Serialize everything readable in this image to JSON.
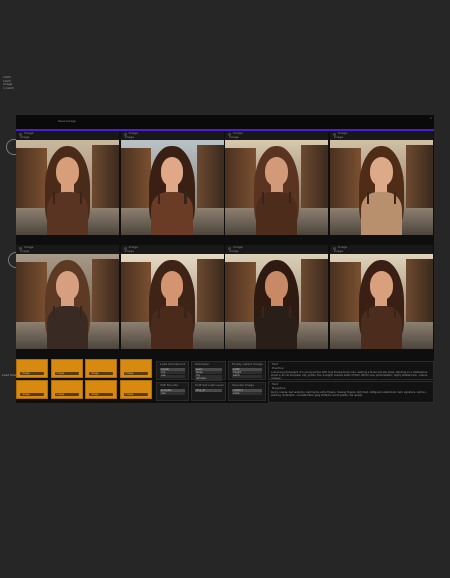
{
  "side_info": {
    "lines": [
      "1024",
      "1024",
      "Image",
      "1 batch"
    ]
  },
  "topbar": {
    "title": "Save Image",
    "right_label": "x"
  },
  "accent_color": "#4b1fd1",
  "orange_color": "#d88a10",
  "grid_rows": [
    {
      "cells": [
        {
          "title": "Image",
          "subtitle": "Image"
        },
        {
          "title": "Image",
          "subtitle": "Image"
        },
        {
          "title": "Image",
          "subtitle": "Image"
        },
        {
          "title": "Image",
          "subtitle": "Image"
        }
      ]
    },
    {
      "cells": [
        {
          "title": "Image",
          "subtitle": "Image"
        },
        {
          "title": "Image",
          "subtitle": "Image"
        },
        {
          "title": "Image",
          "subtitle": "Image"
        },
        {
          "title": "Image",
          "subtitle": "Image"
        }
      ]
    }
  ],
  "bottom": {
    "left_label": "Load Images",
    "orange_buttons": [
      "image",
      "image",
      "image",
      "image",
      "image",
      "image",
      "image",
      "image"
    ],
    "panels": [
      {
        "title": "Load Checkpoint",
        "fields": [
          "model",
          "clip",
          "vae"
        ]
      },
      {
        "title": "KSampler",
        "fields": [
          "seed",
          "steps",
          "cfg",
          "denoise"
        ]
      },
      {
        "title": "Empty Latent Image",
        "fields": [
          "width",
          "height",
          "batch"
        ]
      },
      {
        "title": "VAE Decode",
        "fields": [
          "samples",
          "vae"
        ]
      },
      {
        "title": "CLIP Set Last Layer",
        "fields": [
          "stop_at"
        ]
      },
      {
        "title": "Upscale Image",
        "fields": [
          "method",
          "scale"
        ]
      }
    ],
    "prompts": [
      {
        "title": "Text",
        "sub": "Positive",
        "text": "a stunning photograph of a young woman with long flowing brown hair, wearing a brown silk slip dress, standing on a cobblestone street in an old european city, golden hour sunlight, shallow depth of field, 85mm lens, photorealistic, highly detailed skin, natural makeup"
      },
      {
        "title": "Text",
        "sub": "Negative",
        "text": "blurry, lowres, bad anatomy, bad hands, extra fingers, missing fingers, deformed, disfigured, watermark, text, signature, cartoon, painting, illustration, oversaturated, jpeg artifacts, worst quality, low quality"
      }
    ]
  }
}
